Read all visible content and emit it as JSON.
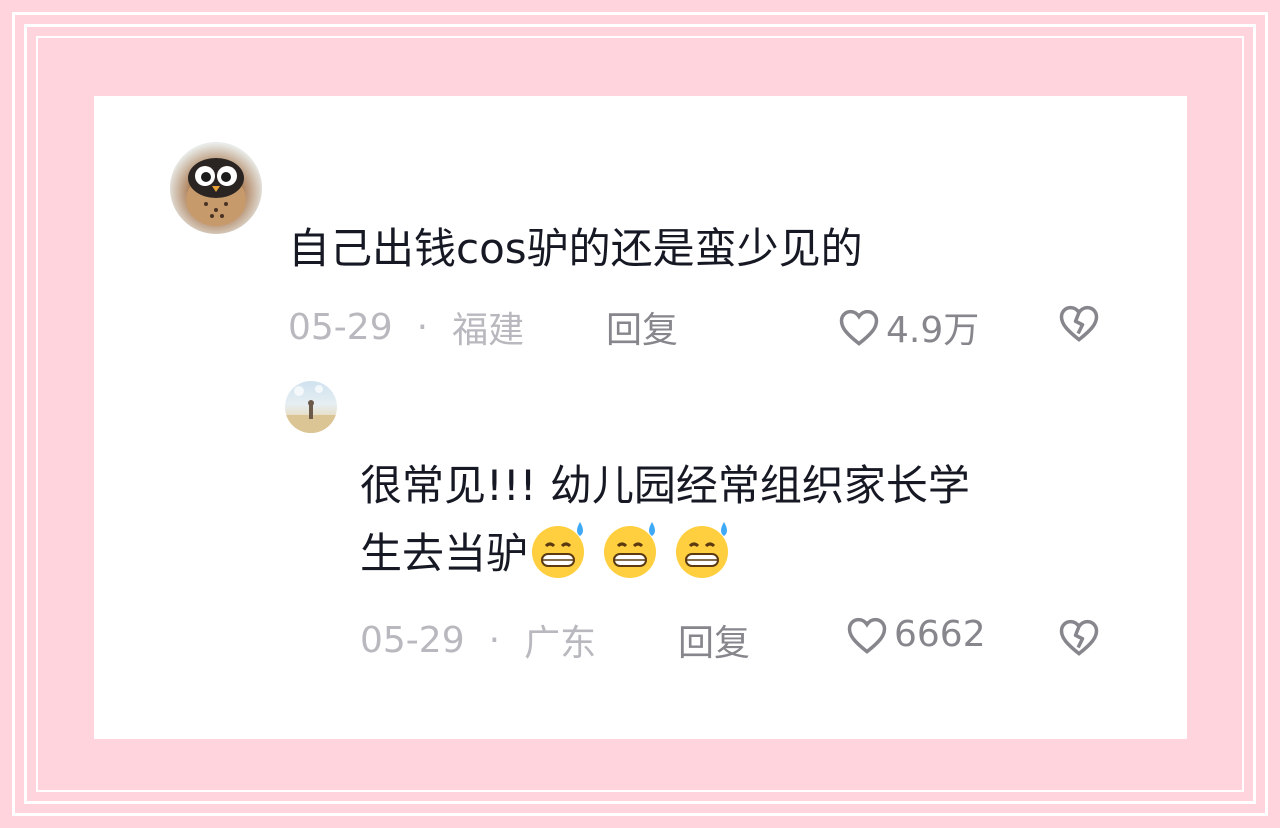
{
  "comments": [
    {
      "text": "自己出钱cos驴的还是蛮少见的",
      "date": "05-29",
      "separator": "·",
      "location": "福建",
      "reply_label": "回复",
      "likes": "4.9万",
      "icons": [
        "heart-icon",
        "broken-heart-icon"
      ]
    },
    {
      "text_line1": "很常见!!! 幼儿园经常组织家长学",
      "text_line2": "生去当驴",
      "emoji_count": 3,
      "emoji_name": "grinning-sweat-emoji",
      "date": "05-29",
      "separator": "·",
      "location": "广东",
      "reply_label": "回复",
      "likes": "6662",
      "icons": [
        "heart-icon",
        "broken-heart-icon"
      ]
    }
  ],
  "colors": {
    "background": "#ffd4dd",
    "card": "#ffffff",
    "text": "#161823",
    "meta": "#b8b8be",
    "action": "#86868c"
  }
}
